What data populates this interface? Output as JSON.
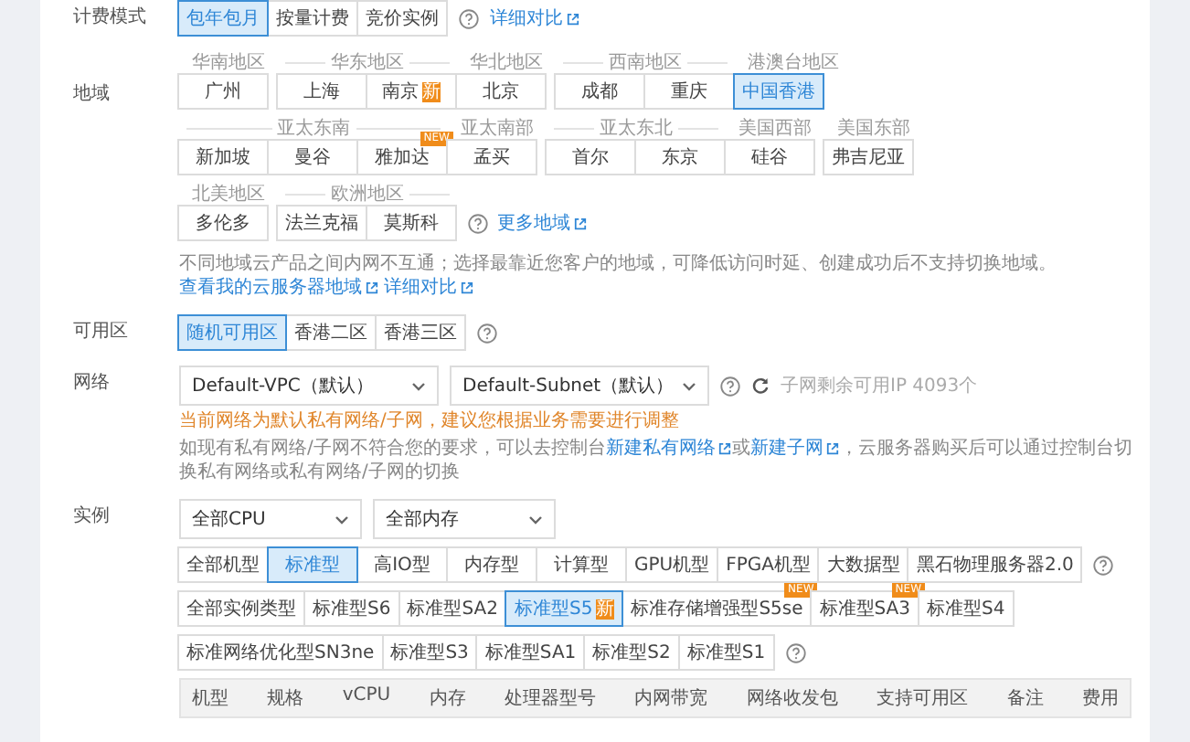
{
  "billing": {
    "label": "计费模式",
    "options": [
      {
        "label": "包年包月",
        "selected": true
      },
      {
        "label": "按量计费",
        "selected": false
      },
      {
        "label": "竞价实例",
        "selected": false
      }
    ],
    "link": "详细对比"
  },
  "region": {
    "label": "地域",
    "rows": [
      {
        "groups": [
          {
            "name": "华南地区",
            "items": [
              {
                "label": "广州",
                "selected": false
              }
            ]
          },
          {
            "name": "华东地区",
            "items": [
              {
                "label": "上海",
                "selected": false
              },
              {
                "label": "南京",
                "selected": false,
                "badge": "新"
              }
            ]
          },
          {
            "name": "华北地区",
            "items": [
              {
                "label": "北京",
                "selected": false
              }
            ]
          },
          {
            "name": "西南地区",
            "items": [
              {
                "label": "成都",
                "selected": false
              },
              {
                "label": "重庆",
                "selected": false
              }
            ]
          },
          {
            "name": "港澳台地区",
            "items": [
              {
                "label": "中国香港",
                "selected": true
              }
            ]
          }
        ]
      },
      {
        "groups": [
          {
            "name": "亚太东南",
            "items": [
              {
                "label": "新加坡",
                "selected": false
              },
              {
                "label": "曼谷",
                "selected": false
              },
              {
                "label": "雅加达",
                "selected": false,
                "badge": "NEW"
              }
            ]
          },
          {
            "name": "亚太南部",
            "items": [
              {
                "label": "孟买",
                "selected": false
              }
            ]
          },
          {
            "name": "亚太东北",
            "items": [
              {
                "label": "首尔",
                "selected": false
              },
              {
                "label": "东京",
                "selected": false
              }
            ]
          },
          {
            "name": "美国西部",
            "items": [
              {
                "label": "硅谷",
                "selected": false
              }
            ]
          },
          {
            "name": "美国东部",
            "items": [
              {
                "label": "弗吉尼亚",
                "selected": false
              }
            ]
          }
        ]
      },
      {
        "groups": [
          {
            "name": "北美地区",
            "items": [
              {
                "label": "多伦多",
                "selected": false
              }
            ]
          },
          {
            "name": "欧洲地区",
            "items": [
              {
                "label": "法兰克福",
                "selected": false
              },
              {
                "label": "莫斯科",
                "selected": false
              }
            ]
          }
        ]
      }
    ],
    "more_link": "更多地域",
    "note": "不同地域云产品之间内网不互通；选择最靠近您客户的地域，可降低访问时延、创建成功后不支持切换地域。",
    "note_links": [
      "查看我的云服务器地域",
      "详细对比"
    ]
  },
  "zone": {
    "label": "可用区",
    "options": [
      {
        "label": "随机可用区",
        "selected": true
      },
      {
        "label": "香港二区",
        "selected": false
      },
      {
        "label": "香港三区",
        "selected": false
      }
    ]
  },
  "network": {
    "label": "网络",
    "vpc": "Default-VPC（默认）",
    "subnet": "Default-Subnet（默认）",
    "ip_info": "子网剩余可用IP 4093个",
    "warning": "当前网络为默认私有网络/子网，建议您根据业务需要进行调整",
    "hint_parts": [
      {
        "kind": "text",
        "text": "如现有私有网络/子网不符合您的要求，可以去控制台"
      },
      {
        "kind": "link",
        "text": "新建私有网络"
      },
      {
        "kind": "text",
        "text": "或"
      },
      {
        "kind": "link",
        "text": "新建子网"
      },
      {
        "kind": "text",
        "text": "，云服务器购买后可以通过控制台切换私有网络或私有网络/子网的切换"
      }
    ]
  },
  "instance": {
    "label": "实例",
    "cpu": "全部CPU",
    "memory": "全部内存",
    "families": [
      {
        "label": "全部机型",
        "selected": false
      },
      {
        "label": "标准型",
        "selected": true
      },
      {
        "label": "高IO型",
        "selected": false
      },
      {
        "label": "内存型",
        "selected": false
      },
      {
        "label": "计算型",
        "selected": false
      },
      {
        "label": "GPU机型",
        "selected": false
      },
      {
        "label": "FPGA机型",
        "selected": false
      },
      {
        "label": "大数据型",
        "selected": false
      },
      {
        "label": "黑石物理服务器2.0",
        "selected": false
      }
    ],
    "types": [
      [
        {
          "label": "全部实例类型",
          "selected": false
        },
        {
          "label": "标准型S6",
          "selected": false
        },
        {
          "label": "标准型SA2",
          "selected": false
        },
        {
          "label": "标准型S5",
          "selected": true,
          "badge": "新"
        },
        {
          "label": "标准存储增强型S5se",
          "selected": false,
          "badge": "NEW"
        },
        {
          "label": "标准型SA3",
          "selected": false,
          "badge": "NEW"
        },
        {
          "label": "标准型S4",
          "selected": false
        }
      ],
      [
        {
          "label": "标准网络优化型SN3ne",
          "selected": false
        },
        {
          "label": "标准型S3",
          "selected": false
        },
        {
          "label": "标准型SA1",
          "selected": false
        },
        {
          "label": "标准型S2",
          "selected": false
        },
        {
          "label": "标准型S1",
          "selected": false
        }
      ]
    ],
    "columns": [
      "机型",
      "规格",
      "vCPU",
      "内存",
      "处理器型号",
      "内网带宽",
      "网络收发包",
      "支持可用区",
      "备注",
      "费用"
    ]
  }
}
